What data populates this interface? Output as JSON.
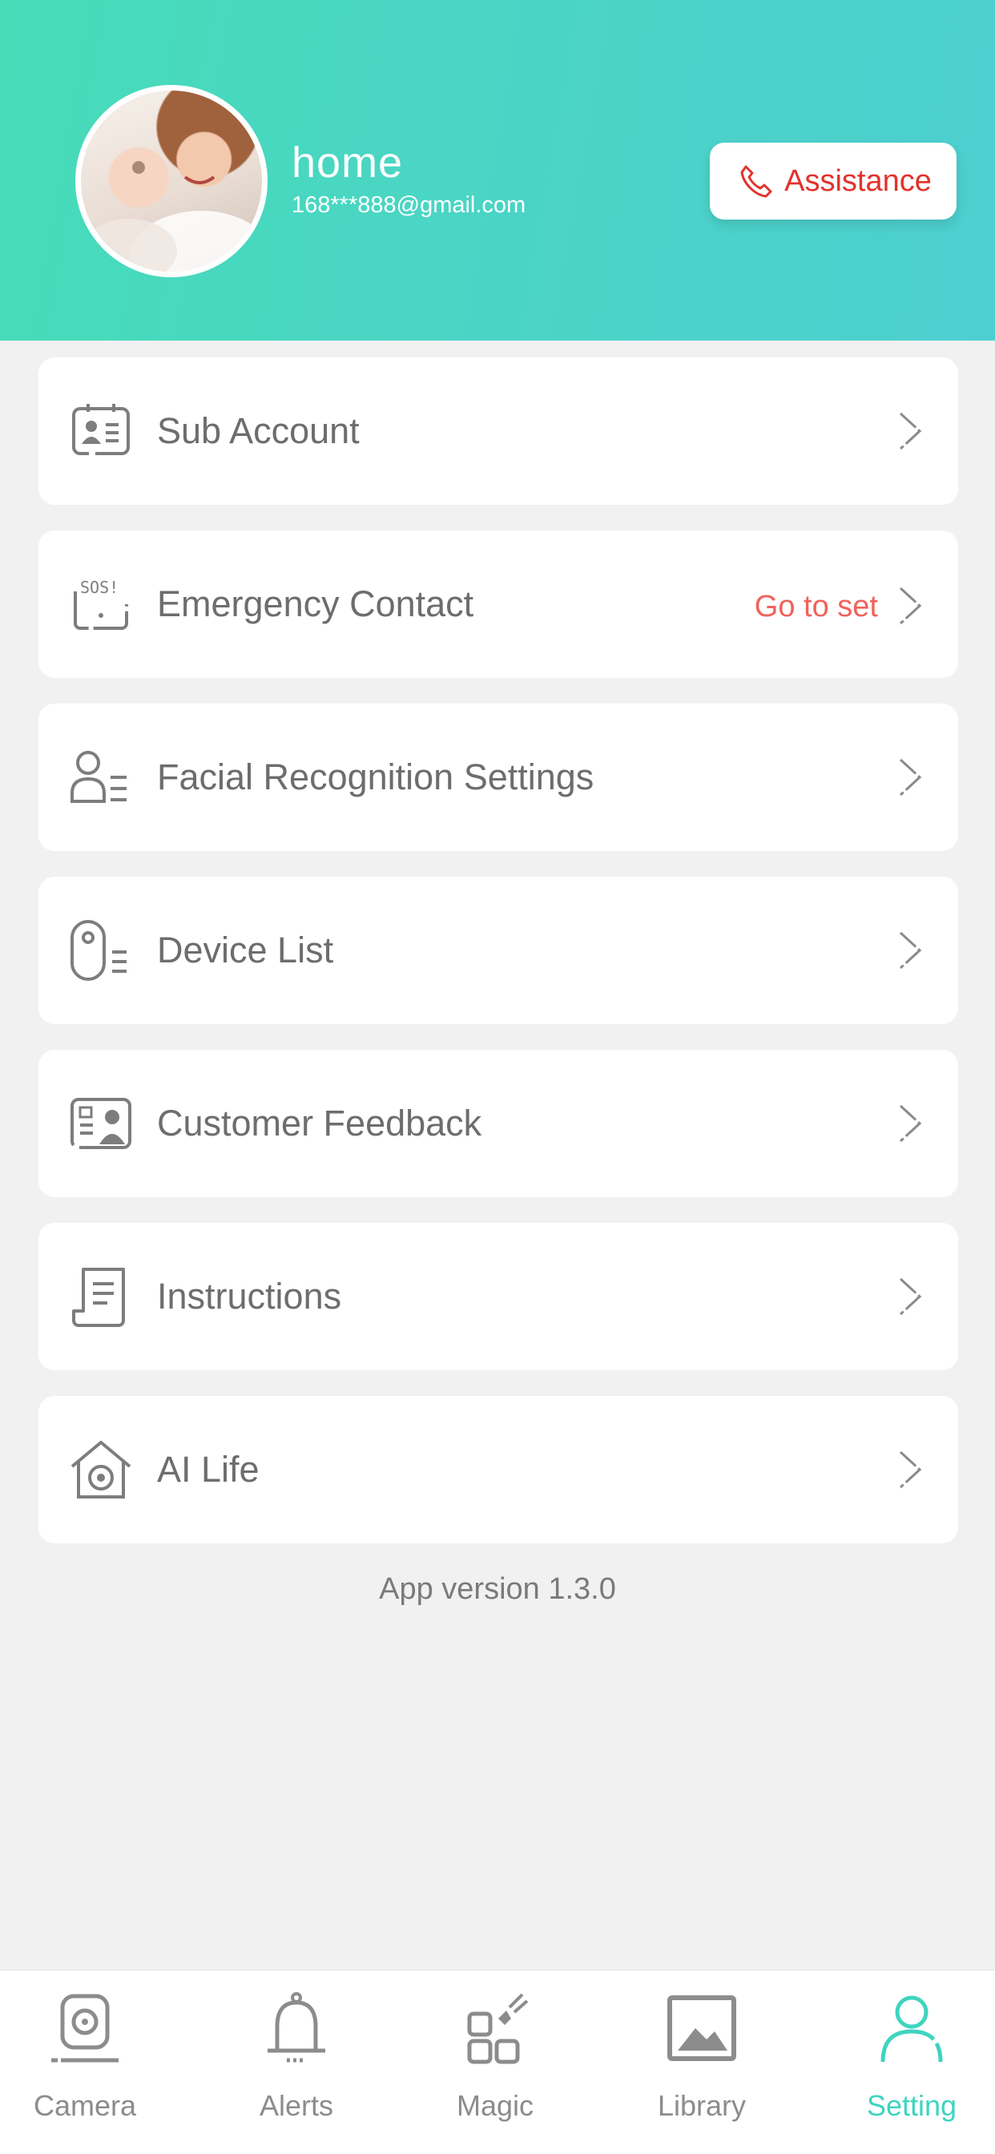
{
  "profile": {
    "name": "home",
    "email": "168***888@gmail.com",
    "assistance_label": "Assistance"
  },
  "menu": [
    {
      "label": "Sub Account",
      "icon": "id-card-icon"
    },
    {
      "label": "Emergency Contact",
      "icon": "sos-icon",
      "extra": "Go to set"
    },
    {
      "label": "Facial Recognition Settings",
      "icon": "face-list-icon"
    },
    {
      "label": "Device List",
      "icon": "device-list-icon"
    },
    {
      "label": "Customer Feedback",
      "icon": "feedback-icon"
    },
    {
      "label": "Instructions",
      "icon": "document-icon"
    },
    {
      "label": "AI Life",
      "icon": "smart-home-icon"
    }
  ],
  "version": "App version 1.3.0",
  "tabs": [
    {
      "label": "Camera",
      "icon": "camera-icon"
    },
    {
      "label": "Alerts",
      "icon": "bell-icon"
    },
    {
      "label": "Magic",
      "icon": "magic-grid-icon"
    },
    {
      "label": "Library",
      "icon": "image-icon"
    },
    {
      "label": "Setting",
      "icon": "person-icon",
      "active": true
    }
  ],
  "colors": {
    "header_gradient_start": "#46dcb8",
    "header_gradient_end": "#4dcfd0",
    "accent_red": "#e2322c",
    "link_red": "#f0625a",
    "active_tab": "#3fd4c0",
    "text_gray": "#6d6d6d",
    "background": "#f1f1f1"
  }
}
